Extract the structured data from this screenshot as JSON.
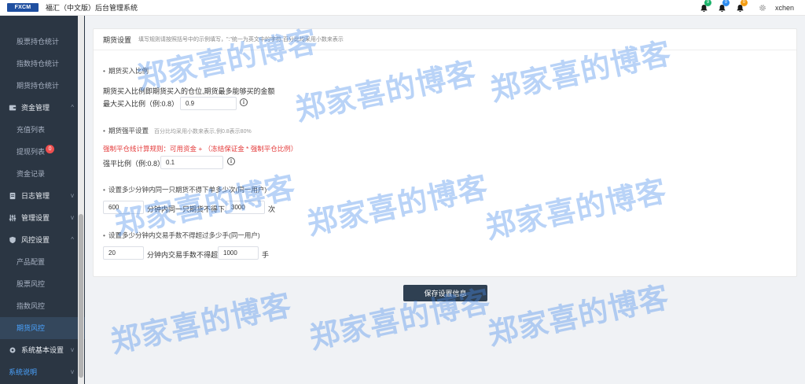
{
  "app": {
    "logo_text": "FXCM",
    "title": "福汇（中文版）后台管理系统"
  },
  "topbar": {
    "notifications": [
      {
        "icon": "bell-icon",
        "badge": "9",
        "badge_color": "#1bb36a"
      },
      {
        "icon": "bell-icon",
        "badge": "0",
        "badge_color": "#2d8cf0"
      },
      {
        "icon": "bell-icon",
        "badge": "0",
        "badge_color": "#f39c12"
      }
    ],
    "settings_icon": "gear-icon",
    "username": "xchen"
  },
  "sidebar": {
    "items": [
      {
        "label": "股票持仓统计",
        "type": "sub"
      },
      {
        "label": "指数持仓统计",
        "type": "sub"
      },
      {
        "label": "期货持仓统计",
        "type": "sub"
      },
      {
        "label": "资金管理",
        "type": "group",
        "icon": "wallet-icon",
        "chevron": "^"
      },
      {
        "label": "充值列表",
        "type": "sub"
      },
      {
        "label": "提现列表",
        "type": "sub",
        "badge": "0"
      },
      {
        "label": "资金记录",
        "type": "sub"
      },
      {
        "label": "日志管理",
        "type": "group",
        "icon": "log-icon",
        "chevron": "v"
      },
      {
        "label": "管理设置",
        "type": "group",
        "icon": "sliders-icon",
        "chevron": "v"
      },
      {
        "label": "风控设置",
        "type": "group",
        "icon": "shield-icon",
        "chevron": "^"
      },
      {
        "label": "产品配置",
        "type": "sub"
      },
      {
        "label": "股票风控",
        "type": "sub"
      },
      {
        "label": "指数风控",
        "type": "sub"
      },
      {
        "label": "期货风控",
        "type": "sub",
        "active": true
      },
      {
        "label": "系统基本设置",
        "type": "group",
        "icon": "cog-icon",
        "chevron": "v"
      },
      {
        "label": "系统说明",
        "type": "link",
        "chevron": "v"
      }
    ]
  },
  "form": {
    "header_title": "期货设置",
    "header_desc": "填写规则请按照括号中的示例填写，\":\"统一为英文中的字符,百分比均采用小数来表示",
    "buy_ratio": {
      "section": "期货买入比例",
      "description": "期货买入比例即期货买入的仓位,期货最多能够买的金额",
      "label": "最大买入比例（例:0.8）",
      "value": "0.9"
    },
    "force_close": {
      "section": "期货强平设置",
      "note": "百分比均采用小数来表示,例0.8表示80%",
      "rule": "强制平仓线计算规则：可用资金 + （冻结保证金 * 强制平仓比例）",
      "label": "强平比例（例:0.8）",
      "value": "0.1"
    },
    "order_limit": {
      "section": "设置多少分钟内同一只期货不得下单多少次(同一用户)",
      "minutes": "600",
      "middle": "分钟内同一只期货不得下单",
      "count": "3000",
      "unit": "次"
    },
    "lot_limit": {
      "section": "设置多少分钟内交易手数不得超过多少手(同一用户)",
      "minutes": "20",
      "middle": "分钟内交易手数不得超过",
      "count": "1000",
      "unit": "手"
    },
    "save_label": "保存设置信息"
  },
  "watermark": "郑家喜的博客"
}
